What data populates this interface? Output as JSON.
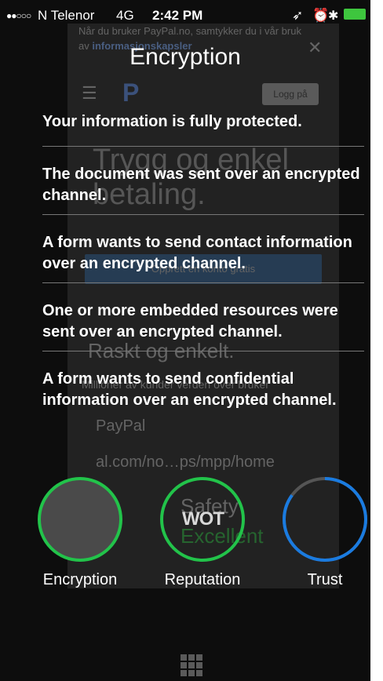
{
  "status_bar": {
    "signal": "●●○○○",
    "carrier": "N Telenor",
    "network": "4G",
    "time": "2:42 PM"
  },
  "background_page": {
    "banner_line1": "Når du bruker PayPal.no, samtykker du i vår bruk",
    "banner_line2_prefix": "av ",
    "banner_link": "informasjonskapsler",
    "login": "Logg på",
    "hero_line1": "Trygg og enkel",
    "hero_line2": "betaling.",
    "cta": "Opprett en konto gratis",
    "heading": "Raskt og enkelt.",
    "subtext": "Millioner av kunder verden over bruker",
    "url_title": "PayPal",
    "url": "al.com/no…ps/mpp/home",
    "safety": "Safety",
    "safety_value": "Excellent"
  },
  "header": {
    "title": "Encryption"
  },
  "summary": "Your information is fully protected.",
  "items": [
    {
      "text": "The document was sent over an encrypted channel."
    },
    {
      "text": "A form wants to send contact information over an encrypted channel."
    },
    {
      "text": "One or more embedded resources were sent over an encrypted channel."
    },
    {
      "text": "A form wants to send confidential information over an encrypted channel."
    }
  ],
  "gauges": {
    "encryption": {
      "label": "Encryption",
      "ring_color": "#22c34a",
      "fill": "#4a4a4a",
      "level": 1.0
    },
    "reputation": {
      "label": "Reputation",
      "ring_color": "#22c34a",
      "logo": "WOT",
      "level": 1.0
    },
    "trust": {
      "label": "Trust",
      "ring_color": "#1a7be0",
      "track_color": "#555555",
      "level": 0.85
    }
  },
  "icons": {
    "apps": "grid-icon",
    "location": "location-arrow-icon",
    "alarm": "alarm-icon",
    "bluetooth": "bluetooth-icon",
    "battery": "battery-icon"
  }
}
